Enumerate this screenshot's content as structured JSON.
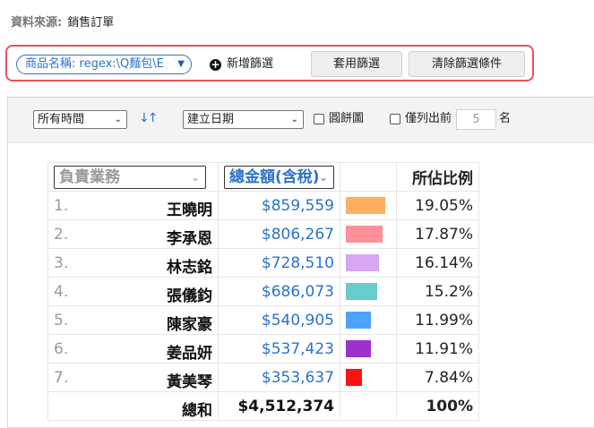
{
  "source": {
    "label": "資料來源:",
    "value": "銷售訂單"
  },
  "filters": {
    "chip_label": "商品名稱: regex:\\Q麵包\\E",
    "add_filter_label": "新增篩選",
    "apply_label": "套用篩選",
    "clear_label": "清除篩選條件"
  },
  "toolbar": {
    "time_select": "所有時間",
    "sort_icon": "↓↑",
    "date_select": "建立日期",
    "pie_label": "圓餅圖",
    "topn_label": "僅列出前",
    "topn_placeholder": "5",
    "topn_suffix": "名"
  },
  "table": {
    "col_owner": "負責業務",
    "col_amount": "總金額(含稅)",
    "col_share": "所佔比例",
    "rows": [
      {
        "rank": "1.",
        "name": "王曉明",
        "amount": "$859,559",
        "share": "19.05%",
        "share_value": 19.05,
        "color": "#ffae62"
      },
      {
        "rank": "2.",
        "name": "李承恩",
        "amount": "$806,267",
        "share": "17.87%",
        "share_value": 17.87,
        "color": "#ff8f99"
      },
      {
        "rank": "3.",
        "name": "林志銘",
        "amount": "$728,510",
        "share": "16.14%",
        "share_value": 16.14,
        "color": "#d8a6f5"
      },
      {
        "rank": "4.",
        "name": "張儀鈞",
        "amount": "$686,073",
        "share": "15.2%",
        "share_value": 15.2,
        "color": "#66cccc"
      },
      {
        "rank": "5.",
        "name": "陳家豪",
        "amount": "$540,905",
        "share": "11.99%",
        "share_value": 11.99,
        "color": "#4aa3ff"
      },
      {
        "rank": "6.",
        "name": "姜品妍",
        "amount": "$537,423",
        "share": "11.91%",
        "share_value": 11.91,
        "color": "#9a33cc"
      },
      {
        "rank": "7.",
        "name": "黃美琴",
        "amount": "$353,637",
        "share": "7.84%",
        "share_value": 7.84,
        "color": "#ff1111"
      }
    ],
    "total_label": "總和",
    "total_amount": "$4,512,374",
    "total_share": "100%"
  }
}
